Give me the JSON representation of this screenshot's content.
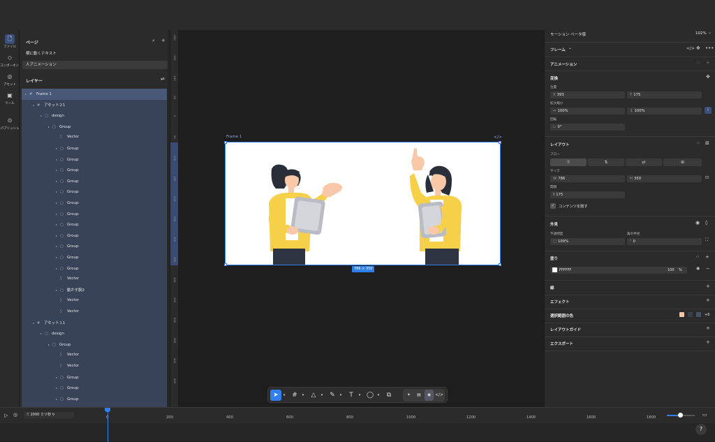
{
  "rail": [
    {
      "name": "file",
      "icon": "file-icon",
      "glyph": "🗋",
      "label": "ファイル",
      "active": true
    },
    {
      "name": "components",
      "icon": "component-icon",
      "glyph": "◇",
      "label": "コンポーネント",
      "active": false
    },
    {
      "name": "assets",
      "icon": "asset-icon",
      "glyph": "◎",
      "label": "アセット",
      "active": false
    },
    {
      "name": "tools",
      "icon": "toolbox-icon",
      "glyph": "▣",
      "label": "ツール",
      "active": false
    },
    {
      "name": "publish",
      "icon": "publish-icon",
      "glyph": "⊙",
      "label": "パブリッシュ",
      "active": false
    }
  ],
  "pages": {
    "title": "ページ",
    "items": [
      {
        "label": "横に動くテキスト",
        "selected": false
      },
      {
        "label": "人アニメーション",
        "selected": true
      }
    ]
  },
  "layers": {
    "title": "レイヤー",
    "items": [
      {
        "label": "Frame 1",
        "depth": 0,
        "icon": "frame",
        "caret": true
      },
      {
        "label": "アセット２1",
        "depth": 1,
        "icon": "frame",
        "caret": true
      },
      {
        "label": "design",
        "depth": 2,
        "icon": "group",
        "caret": true
      },
      {
        "label": "Group",
        "depth": 3,
        "icon": "group",
        "caret": true
      },
      {
        "label": "Vector",
        "depth": 4,
        "icon": "vector",
        "caret": false
      },
      {
        "label": "Group",
        "depth": 4,
        "icon": "group",
        "caret": true
      },
      {
        "label": "Group",
        "depth": 4,
        "icon": "group",
        "caret": true
      },
      {
        "label": "Group",
        "depth": 4,
        "icon": "group",
        "caret": true
      },
      {
        "label": "Group",
        "depth": 4,
        "icon": "group",
        "caret": true
      },
      {
        "label": "Group",
        "depth": 4,
        "icon": "group",
        "caret": true
      },
      {
        "label": "Group",
        "depth": 4,
        "icon": "group",
        "caret": true
      },
      {
        "label": "Group",
        "depth": 4,
        "icon": "group",
        "caret": true
      },
      {
        "label": "Group",
        "depth": 4,
        "icon": "group",
        "caret": true
      },
      {
        "label": "Group",
        "depth": 4,
        "icon": "group",
        "caret": true
      },
      {
        "label": "Group",
        "depth": 4,
        "icon": "group",
        "caret": true
      },
      {
        "label": "Group",
        "depth": 4,
        "icon": "group",
        "caret": true
      },
      {
        "label": "Group",
        "depth": 4,
        "icon": "group",
        "caret": true
      },
      {
        "label": "Vector",
        "depth": 4,
        "icon": "vector",
        "caret": false
      },
      {
        "label": "動かす腕2",
        "depth": 4,
        "icon": "group",
        "caret": true
      },
      {
        "label": "Vector",
        "depth": 4,
        "icon": "vector",
        "caret": false
      },
      {
        "label": "Vector",
        "depth": 4,
        "icon": "vector",
        "caret": false
      },
      {
        "label": "アセット１1",
        "depth": 1,
        "icon": "frame",
        "caret": true
      },
      {
        "label": "design",
        "depth": 2,
        "icon": "group",
        "caret": true
      },
      {
        "label": "Group",
        "depth": 3,
        "icon": "group",
        "caret": true
      },
      {
        "label": "Vector",
        "depth": 4,
        "icon": "vector",
        "caret": false
      },
      {
        "label": "Vector",
        "depth": 4,
        "icon": "vector",
        "caret": false
      },
      {
        "label": "Group",
        "depth": 4,
        "icon": "group",
        "caret": true
      },
      {
        "label": "Group",
        "depth": 4,
        "icon": "group",
        "caret": true
      },
      {
        "label": "Group",
        "depth": 4,
        "icon": "group",
        "caret": true
      }
    ]
  },
  "ruler_ticks": [
    "-200",
    "-150",
    "-100",
    "-50",
    "0",
    "50",
    "100",
    "150",
    "200",
    "250",
    "300",
    "350",
    "400",
    "450",
    "500",
    "550",
    "600",
    "650"
  ],
  "canvas": {
    "frame_label": "Frame 1",
    "frame_code_icon": "</>",
    "size_badge": "786 × 350"
  },
  "toolbar": [
    {
      "name": "select-tool",
      "icon": "cursor-icon",
      "glyph": "➤",
      "selected": true
    },
    {
      "name": "frame-tool",
      "icon": "frame-icon",
      "glyph": "#",
      "selected": false
    },
    {
      "name": "shape-tool",
      "icon": "triangle-icon",
      "glyph": "△",
      "selected": false
    },
    {
      "name": "pen-tool",
      "icon": "pen-icon",
      "glyph": "✎",
      "selected": false
    },
    {
      "name": "text-tool",
      "icon": "text-icon",
      "glyph": "T",
      "selected": false
    },
    {
      "name": "comment-tool",
      "icon": "comment-icon",
      "glyph": "◯",
      "selected": false
    },
    {
      "name": "component-tool",
      "icon": "components-icon",
      "glyph": "⧉",
      "selected": false
    }
  ],
  "toolbar_modes": [
    "✦",
    "▤",
    "◉",
    "</>"
  ],
  "right": {
    "mode": "モーション  ベータ版",
    "zoom": "102%",
    "frame_title": "フレーム",
    "animation_title": "アニメーション",
    "transform_title": "変換",
    "position_label": "位置",
    "x_prefix": "X",
    "x_value": "393",
    "y_prefix": "Y",
    "y_value": "175",
    "scale_label": "拡大縮小",
    "scale_x": "100%",
    "scale_y": "100%",
    "rotate_label": "回転",
    "rotate_value": "0°",
    "layout_title": "レイアウト",
    "flow_label": "フロー",
    "size_label": "サイズ",
    "w_prefix": "W",
    "w_value": "786",
    "h_prefix": "H",
    "h_value": "350",
    "gap_label": "間隔",
    "gap_value": "175",
    "clip_label": "コンテンツを隠す",
    "appearance_title": "外見",
    "opacity_label": "不透明度",
    "opacity_value": "100%",
    "radius_label": "角の半径",
    "radius_value": "0",
    "fill_title": "塗り",
    "fill_hex": "FFFFFF",
    "fill_opacity": "100",
    "fill_unit": "%",
    "stroke_title": "線",
    "effects_title": "エフェクト",
    "selection_colors_title": "選択範囲の色",
    "selection_colors_more": "+6",
    "layout_guide_title": "レイアウトガイド",
    "export_title": "エクスポート"
  },
  "colors": {
    "accent": "#2f80ed",
    "fill": "#FFFFFF",
    "sel1": "#f7c6a7",
    "sel2": "#3a3f4a",
    "sel3": "#475166",
    "shirt": "#f7d04a",
    "hair": "#2a2e38",
    "skin": "#f8c8a8",
    "tablet": "#b9bcc4",
    "pants": "#2f3442"
  },
  "timeline": {
    "duration": "2000",
    "unit": "ミリ秒",
    "ticks": [
      "0",
      "200",
      "400",
      "600",
      "800",
      "1000",
      "1200",
      "1400",
      "1600",
      "1800"
    ],
    "zoom_level": 0.48
  }
}
